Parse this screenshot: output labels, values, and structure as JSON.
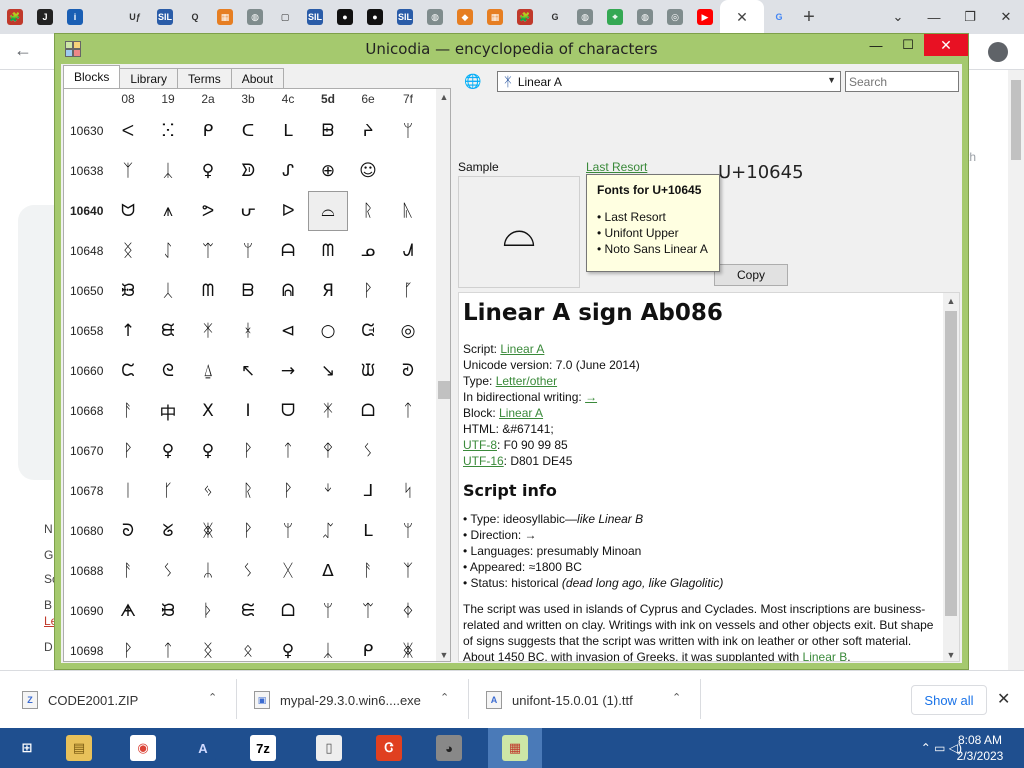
{
  "browser": {
    "tabs": [
      {
        "icon": "puzzle-icon",
        "label": "🧩",
        "bg": "#c0392b"
      },
      {
        "icon": "letter-j-icon",
        "label": "J",
        "bg": "#222222"
      },
      {
        "icon": "info-icon",
        "label": "i",
        "bg": "#1a5fb4"
      },
      {
        "icon": "blank-icon",
        "label": "",
        "bg": "#dee1e6"
      },
      {
        "icon": "uf-icon",
        "label": "Uƒ",
        "bg": "#dee1e6"
      },
      {
        "icon": "sil-icon",
        "label": "SIL",
        "bg": "#2a5ca8"
      },
      {
        "icon": "q-icon",
        "label": "Q",
        "bg": "#dee1e6"
      },
      {
        "icon": "tiles-icon",
        "label": "▦",
        "bg": "#e67e22"
      },
      {
        "icon": "globe-icon",
        "label": "◍",
        "bg": "#7f8c8d"
      },
      {
        "icon": "doc-icon",
        "label": "▢",
        "bg": "#dee1e6"
      },
      {
        "icon": "sil-icon",
        "label": "SIL",
        "bg": "#2a5ca8"
      },
      {
        "icon": "dark-circle-icon",
        "label": "●",
        "bg": "#111111"
      },
      {
        "icon": "dark-circle-icon",
        "label": "●",
        "bg": "#111111"
      },
      {
        "icon": "sil-icon",
        "label": "SIL",
        "bg": "#2a5ca8"
      },
      {
        "icon": "globe-icon",
        "label": "◍",
        "bg": "#7f8c8d"
      },
      {
        "icon": "diamond-icon",
        "label": "◆",
        "bg": "#e67e22"
      },
      {
        "icon": "tiles-icon",
        "label": "▦",
        "bg": "#e67e22"
      },
      {
        "icon": "puzzle-icon",
        "label": "🧩",
        "bg": "#c0392b"
      },
      {
        "icon": "google-icon",
        "label": "G",
        "bg": "#dee1e6"
      },
      {
        "icon": "globe-icon",
        "label": "◍",
        "bg": "#7f8c8d"
      },
      {
        "icon": "maps-icon",
        "label": "⌖",
        "bg": "#34a853"
      },
      {
        "icon": "globe-icon",
        "label": "◍",
        "bg": "#7f8c8d"
      },
      {
        "icon": "chrome-icon",
        "label": "◎",
        "bg": "#7f8c8d"
      },
      {
        "icon": "youtube-icon",
        "label": "▶",
        "bg": "#ff0000"
      }
    ],
    "active_tab_close": "✕",
    "second_google": "G",
    "new_tab": "+",
    "win_minimize": "—",
    "win_restore": "❐",
    "win_close": "✕",
    "win_tabsearch": "⌄",
    "back": "←"
  },
  "app": {
    "title": "Unicodia — encyclopedia of characters",
    "controls": {
      "minimize": "—",
      "maximize": "☐",
      "close": "✕"
    },
    "tabs": [
      "Blocks",
      "Library",
      "Terms",
      "About"
    ],
    "active_tab": "Blocks",
    "grid": {
      "columns": [
        "08",
        "19",
        "2a",
        "3b",
        "4c",
        "5d",
        "6e",
        "7f"
      ],
      "bold_column": "5d",
      "rows": [
        {
          "code": "10630",
          "glyphs": [
            "ⵦ",
            "ⵘ",
            "ᑭ",
            "ᑕ",
            "ᒪ",
            "ᗸ",
            "ᔨ",
            "ᛘ"
          ]
        },
        {
          "code": "10638",
          "glyphs": [
            "ᛉ",
            "ᛣ",
            "♀",
            "ᗥ",
            "ᔑ",
            "⊕",
            "☺",
            ""
          ]
        },
        {
          "code": "10640",
          "glyphs": [
            "ᗢ",
            "⩚",
            "ᕗ",
            "ᕂ",
            "ᐅ",
            "⌓",
            "ᚱ",
            "ᚣ"
          ]
        },
        {
          "code": "10648",
          "glyphs": [
            "ᛝ",
            "ᛇ",
            "ᛠ",
            "ᛘ",
            "ᗩ",
            "ᗰ",
            "ᓄ",
            "ᗂ"
          ]
        },
        {
          "code": "10650",
          "glyphs": [
            "ᙟ",
            "ᛸ",
            "ᗰ",
            "ᗷ",
            "ᕱ",
            "Я",
            "ᚹ",
            "ᚵ"
          ]
        },
        {
          "code": "10658",
          "glyphs": [
            "↑",
            "ᙙ",
            "ᛡ",
            "ᚼ",
            "⊲",
            "○",
            "ᙍ",
            "◎"
          ]
        },
        {
          "code": "10660",
          "glyphs": [
            "ᙅ",
            "ᘓ",
            "⍙",
            "↖",
            "→",
            "↘",
            "ᙡ",
            "ᘑ"
          ]
        },
        {
          "code": "10668",
          "glyphs": [
            "ᚨ",
            "中",
            "X",
            "I",
            "ᗜ",
            "ᛡ",
            "ᗝ",
            "ᛏ"
          ]
        },
        {
          "code": "10670",
          "glyphs": [
            "ᚹ",
            "♀",
            "♀",
            "ᚹ",
            "ᛏ",
            "ᛳ",
            "ᛊ",
            ""
          ]
        },
        {
          "code": "10678",
          "glyphs": [
            "ᛁ",
            "ᚴ",
            "ᛃ",
            "ᚱ",
            "ᚹ",
            "ᛎ",
            "ᒧ",
            "ᛋ"
          ]
        },
        {
          "code": "10680",
          "glyphs": [
            "ᘐ",
            "ᘜ",
            "ᛤ",
            "ᚹ",
            "ᛘ",
            "ᛢ",
            "ᒪ",
            "ᛘ"
          ]
        },
        {
          "code": "10688",
          "glyphs": [
            "ᚨ",
            "ᛊ",
            "ᛦ",
            "ᛊ",
            "ᚷ",
            "ᐃ",
            "ᚨ",
            "ᛉ"
          ]
        },
        {
          "code": "10690",
          "glyphs": [
            "ᗗ",
            "ᙝ",
            "ᚦ",
            "ᙓ",
            "ᗝ",
            "ᛘ",
            "ᛠ",
            "ᛄ"
          ]
        },
        {
          "code": "10698",
          "glyphs": [
            "ᚹ",
            "ᛏ",
            "ᛝ",
            "ᛟ",
            "♀",
            "ᛣ",
            "ᑭ",
            "ᛤ"
          ]
        }
      ],
      "selected_row": "10640",
      "selected_col": "5d"
    },
    "toolbar": {
      "block_name": "Linear A",
      "block_glyph": "ᛡ",
      "search_placeholder": "Search"
    },
    "sample": {
      "label": "Sample",
      "font_link": "Last Resort",
      "codepoint": "U+10645",
      "glyph": "⌓",
      "copy_label": "Copy"
    },
    "tooltip": {
      "title": "Fonts for U+10645",
      "items": [
        "• Last Resort",
        "• Unifont Upper",
        "• Noto Sans Linear A"
      ]
    },
    "info": {
      "title": "Linear A sign Ab086",
      "script_label": "Script: ",
      "script_value": "Linear A",
      "version": "Unicode version: 7.0 (June 2014)",
      "type_label": "Type: ",
      "type_value": "Letter/other",
      "bidi_label": "In bidirectional writing: ",
      "bidi_value": "→",
      "block_label": "Block: ",
      "block_value": "Linear A",
      "html": "HTML: &#67141;",
      "utf8_label": "UTF-8",
      "utf8_value": ": F0 90 99 85",
      "utf16_label": "UTF-16",
      "utf16_value": ": D801 DE45",
      "script_info_heading": "Script info",
      "type_line_prefix": "• Type: ideosyllabic—",
      "type_line_italic": "like Linear B",
      "direction": "• Direction: →",
      "languages": "• Languages: presumably Minoan",
      "appeared": "• Appeared: ≈1800 BC",
      "status_prefix": "• Status: historical ",
      "status_italic": "(dead long ago, like Glagolitic)",
      "paragraph_main": "The script was used in islands of Cyprus and Cyclades. Most inscriptions are business-related and written on clay. Writings with ink on vessels and other objects exit. But shape of signs suggests that the script was written with ink on leather or other soft material. About 1450 BC, with invasion of Greeks, it was supplanted with ",
      "paragraph_link": "Linear B",
      "paragraph_end": "."
    }
  },
  "background_page": {
    "right_text": "th",
    "left_letters": [
      "N",
      "G",
      "Sc",
      "B",
      "Le",
      "D"
    ]
  },
  "downloads": {
    "items": [
      {
        "name": "CODE2001.ZIP",
        "icon": "Z"
      },
      {
        "name": "mypal-29.3.0.win6....exe",
        "icon": "▣"
      },
      {
        "name": "unifont-15.0.01 (1).ttf",
        "icon": "A"
      }
    ],
    "chevron": "⌃",
    "show_all": "Show all",
    "close": "✕"
  },
  "taskbar": {
    "apps": [
      {
        "name": "start-button",
        "glyph": "⊞",
        "bg": "#1f4f8f",
        "color": "#ffffff"
      },
      {
        "name": "file-explorer-icon",
        "glyph": "▤",
        "bg": "#e8c15a",
        "color": "#7a5a10"
      },
      {
        "name": "chrome-icon",
        "glyph": "◉",
        "bg": "#ffffff",
        "color": "#db4437"
      },
      {
        "name": "vector-app-icon",
        "glyph": "A",
        "bg": "#1f4f8f",
        "color": "#cfd9ff"
      },
      {
        "name": "7zip-icon",
        "glyph": "7z",
        "bg": "#ffffff",
        "color": "#000000"
      },
      {
        "name": "document-icon",
        "glyph": "▯",
        "bg": "#eeeeee",
        "color": "#555555"
      },
      {
        "name": "pdf-app-icon",
        "glyph": "Ꮳ",
        "bg": "#e04020",
        "color": "#ffffff"
      },
      {
        "name": "raccoon-icon",
        "glyph": "◕",
        "bg": "#888888",
        "color": "#222222"
      },
      {
        "name": "unicodia-icon",
        "glyph": "▦",
        "bg": "#cde6a6",
        "color": "#c0392b"
      }
    ],
    "active_app": "unicodia-icon",
    "tray": "⌃  ▭  ◁)",
    "time": "8:08 AM",
    "date": "2/3/2023"
  }
}
